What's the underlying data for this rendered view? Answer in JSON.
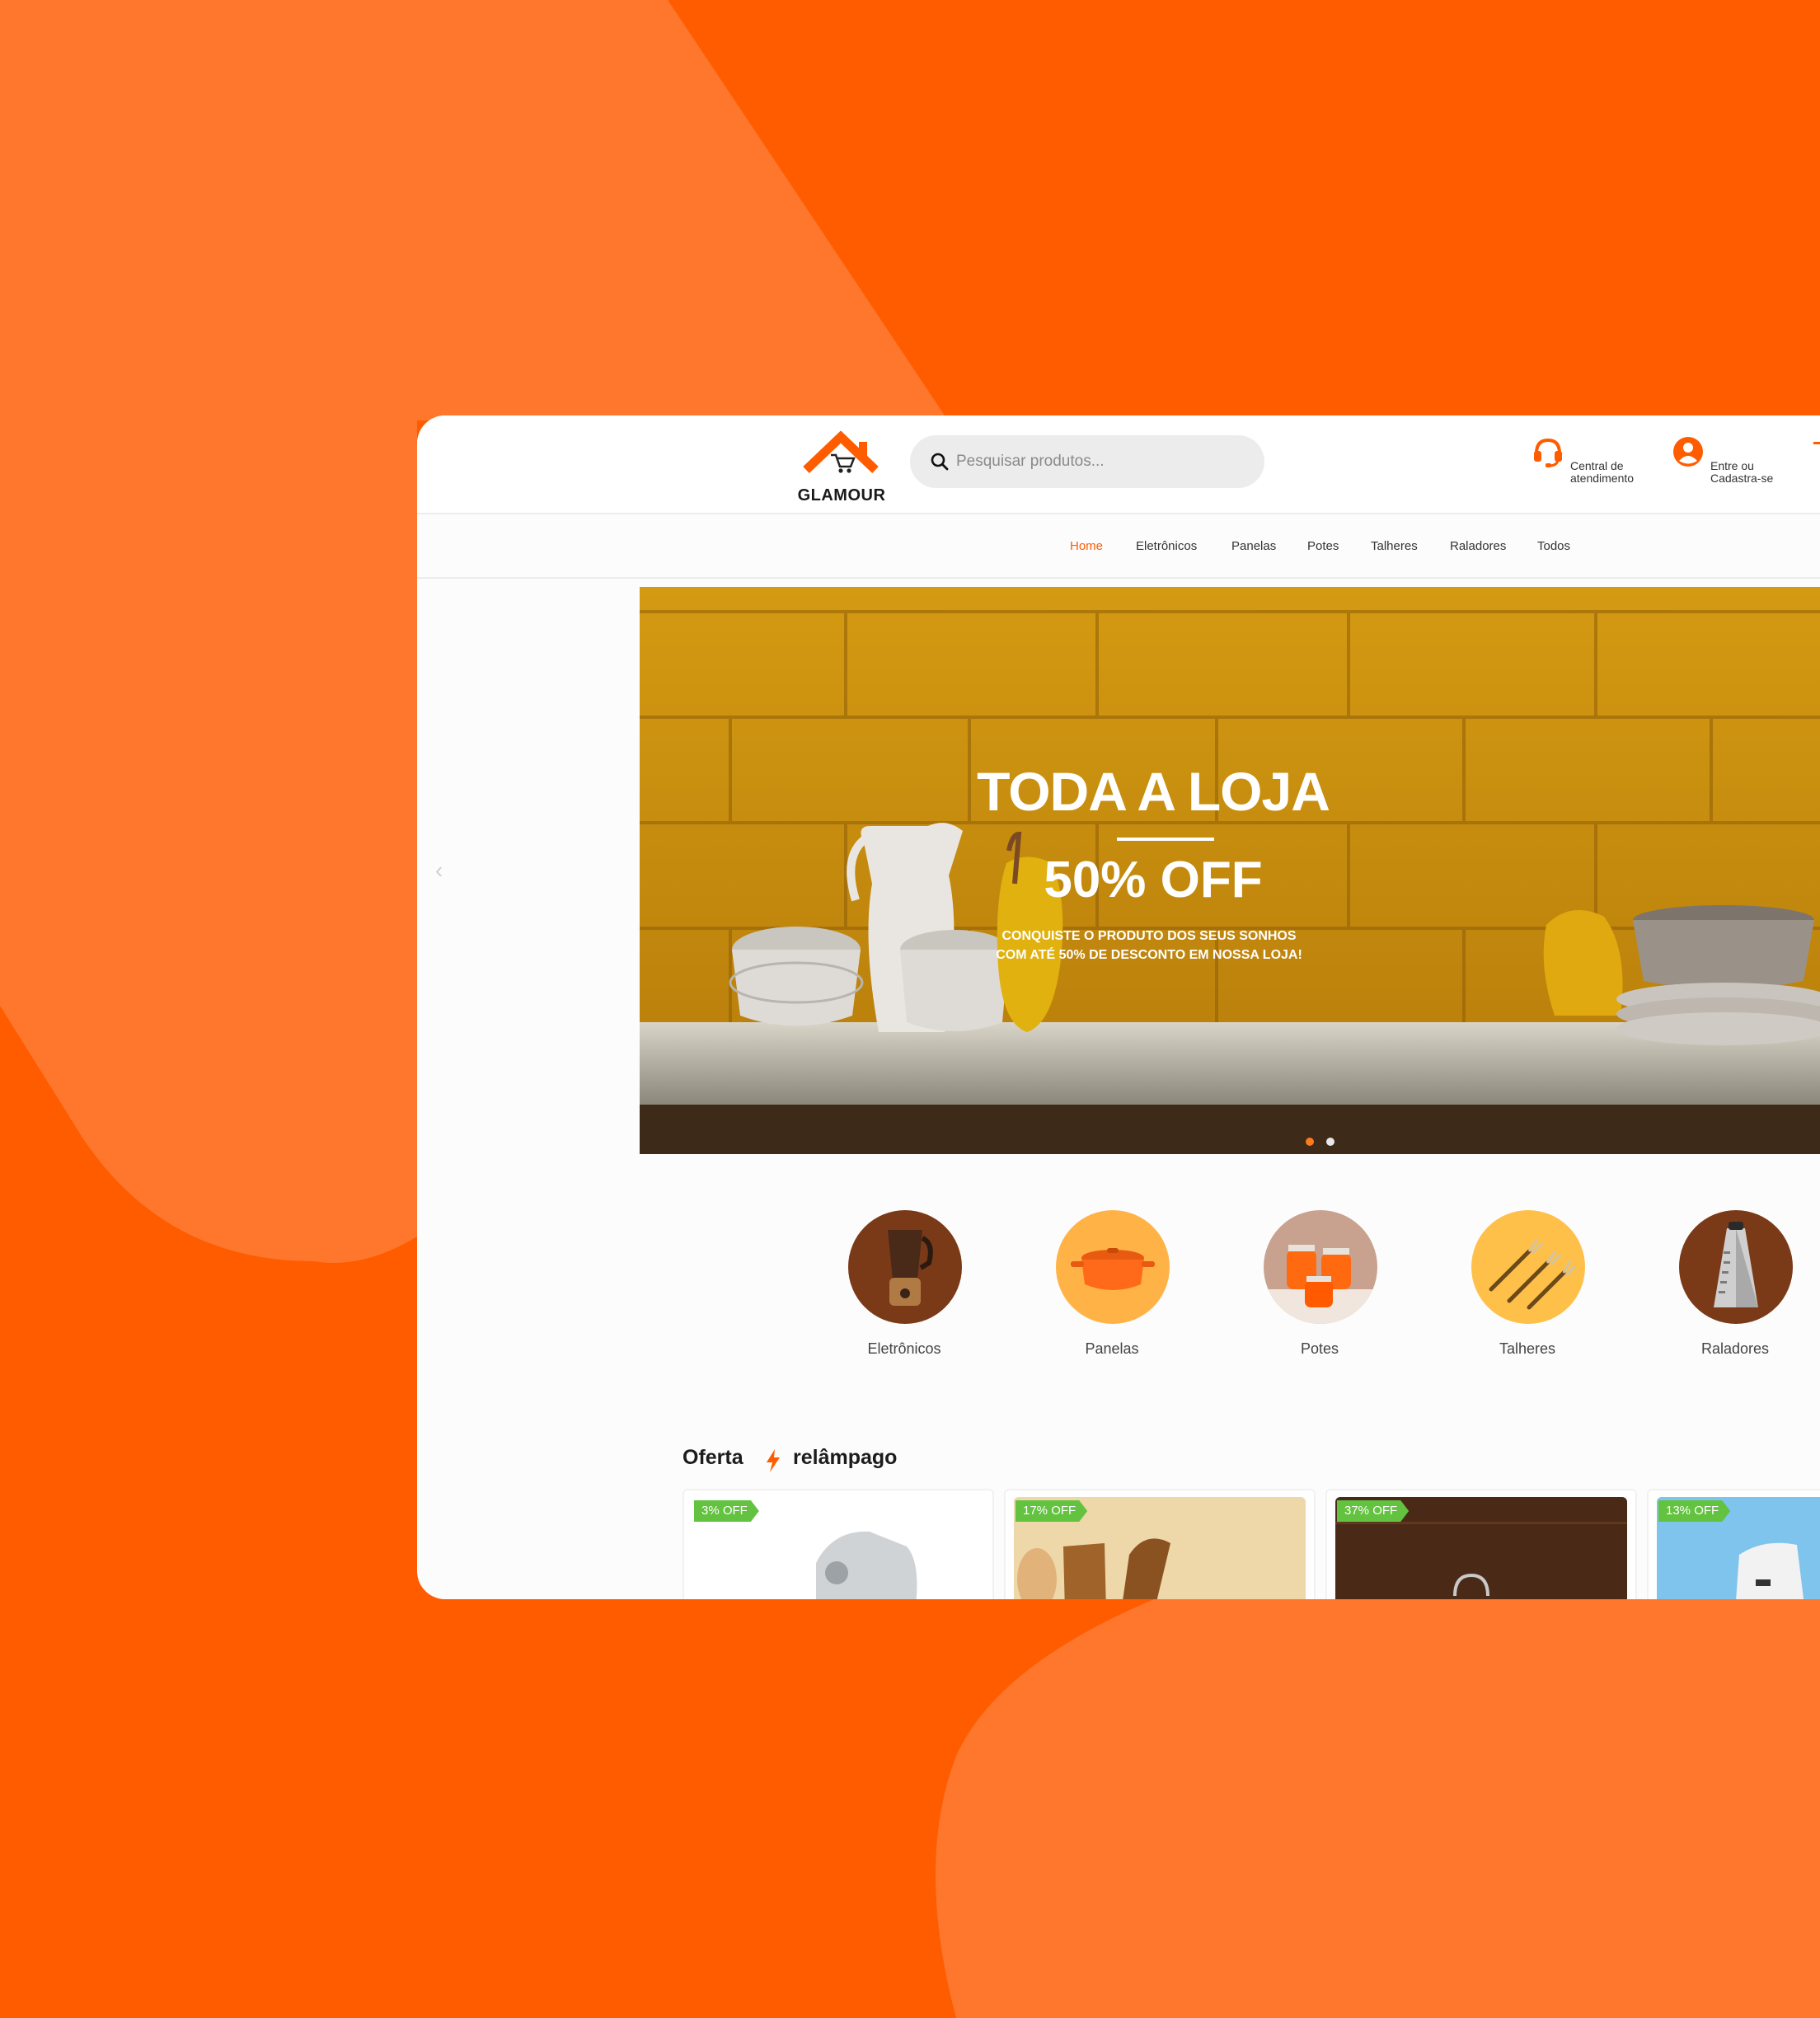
{
  "brand": {
    "name": "GLAMOUR",
    "accent_color": "#ff5c00"
  },
  "header": {
    "search_placeholder": "Pesquisar produtos...",
    "support": {
      "icon": "headset-icon",
      "line1": "Central de",
      "line2": "atendimento"
    },
    "account": {
      "icon": "user-icon",
      "line1": "Entre ou",
      "line2": "Cadastra-se"
    }
  },
  "nav": {
    "items": [
      {
        "label": "Home",
        "active": true
      },
      {
        "label": "Eletrônicos",
        "active": false
      },
      {
        "label": "Panelas",
        "active": false
      },
      {
        "label": "Potes",
        "active": false
      },
      {
        "label": "Talheres",
        "active": false
      },
      {
        "label": "Raladores",
        "active": false
      },
      {
        "label": "Todos",
        "active": false
      }
    ]
  },
  "banner": {
    "title": "TODA A LOJA",
    "discount": "50% OFF",
    "subtitle": "CONQUISTE O PRODUTO DOS SEUS SONHOS COM ATÉ 50% DE DESCONTO EM NOSSA LOJA!",
    "active_slide": 1,
    "slide_count": 2
  },
  "categories": [
    {
      "label": "Eletrônicos",
      "icon": "blender-icon"
    },
    {
      "label": "Panelas",
      "icon": "pot-icon"
    },
    {
      "label": "Potes",
      "icon": "jar-icon"
    },
    {
      "label": "Talheres",
      "icon": "forks-icon"
    },
    {
      "label": "Raladores",
      "icon": "grater-icon"
    }
  ],
  "flash_sale": {
    "title_part1": "Oferta",
    "title_part2": "relâmpago",
    "icon": "lightning-icon",
    "products": [
      {
        "badge": "3% OFF"
      },
      {
        "badge": "17% OFF"
      },
      {
        "badge": "37% OFF"
      },
      {
        "badge": "13% OFF"
      }
    ]
  }
}
